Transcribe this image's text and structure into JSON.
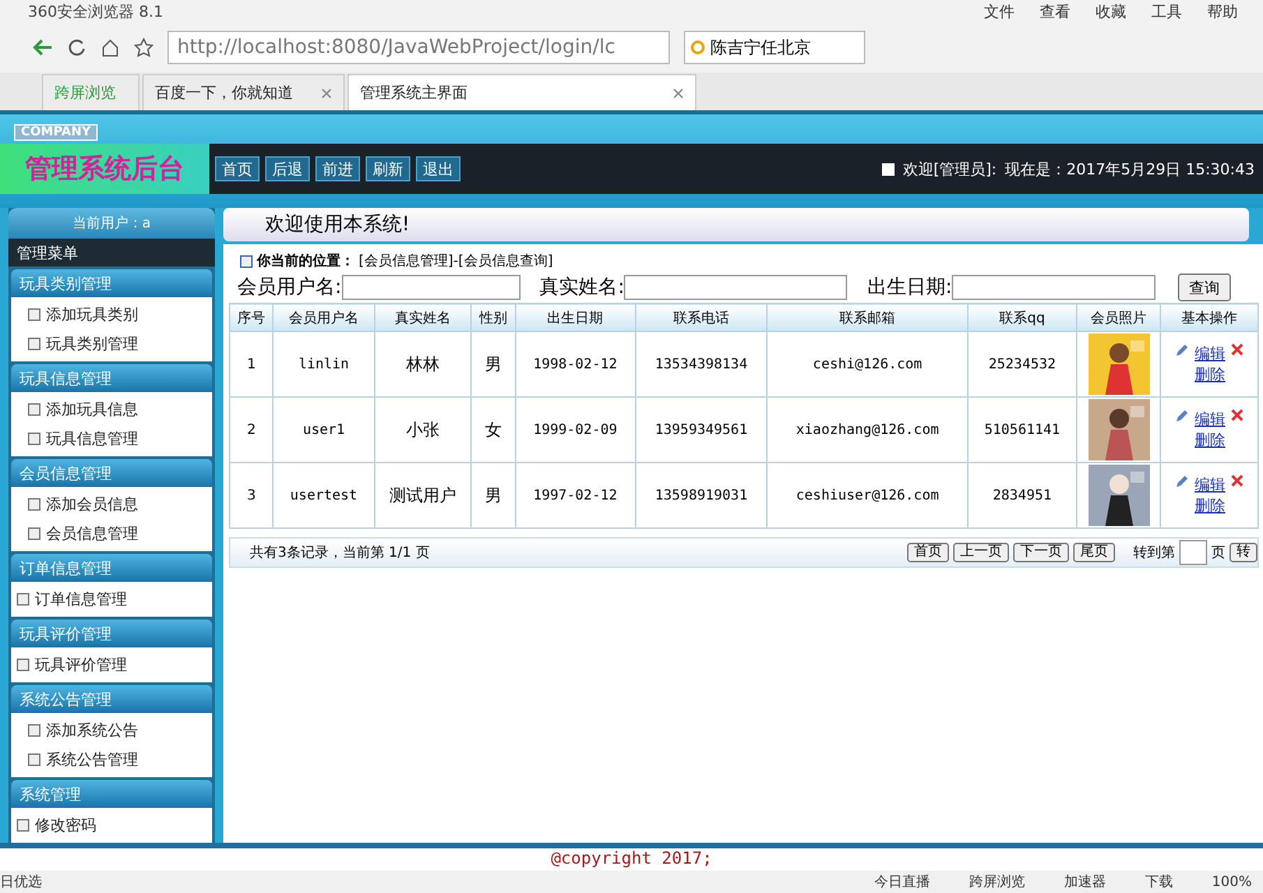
{
  "browser": {
    "title": "360安全浏览器 8.1",
    "menu": [
      "文件",
      "查看",
      "收藏",
      "工具",
      "帮助"
    ],
    "url": "http://localhost:8080/JavaWebProject/login/lc",
    "search": "陈吉宁任北京",
    "tabs": [
      {
        "label": "跨屏浏览",
        "selected": false,
        "closable": false
      },
      {
        "label": "百度一下，你就知道",
        "selected": false,
        "closable": true
      },
      {
        "label": "管理系统主界面",
        "selected": true,
        "closable": true
      }
    ]
  },
  "header": {
    "company": "COMPANY",
    "title": "管理系统后台",
    "nav": [
      "首页",
      "后退",
      "前进",
      "刷新",
      "退出"
    ],
    "welcome": "欢迎[管理员]:",
    "time": "现在是：2017年5月29日 15:30:43"
  },
  "sidebar": {
    "user": "当前用户：a",
    "menu_title": "管理菜单",
    "groups": [
      {
        "title": "玩具类别管理",
        "items": [
          "添加玩具类别",
          "玩具类别管理"
        ]
      },
      {
        "title": "玩具信息管理",
        "items": [
          "添加玩具信息",
          "玩具信息管理"
        ]
      },
      {
        "title": "会员信息管理",
        "items": [
          "添加会员信息",
          "会员信息管理"
        ]
      },
      {
        "title": "订单信息管理",
        "items": [
          "订单信息管理"
        ]
      },
      {
        "title": "玩具评价管理",
        "items": [
          "玩具评价管理"
        ]
      },
      {
        "title": "系统公告管理",
        "items": [
          "添加系统公告",
          "系统公告管理"
        ]
      },
      {
        "title": "系统管理",
        "items": [
          "修改密码"
        ]
      }
    ]
  },
  "main": {
    "welcome": "欢迎使用本系统!",
    "location_label": "你当前的位置：",
    "location": "[会员信息管理]-[会员信息查询]",
    "filters": [
      {
        "label": "会员用户名:"
      },
      {
        "label": "真实姓名:"
      },
      {
        "label": "出生日期:"
      }
    ],
    "query_button": "查询",
    "table": {
      "columns": [
        "序号",
        "会员用户名",
        "真实姓名",
        "性别",
        "出生日期",
        "联系电话",
        "联系邮箱",
        "联系qq",
        "会员照片",
        "基本操作"
      ],
      "rows": [
        {
          "cells": [
            "1",
            "linlin",
            "林林",
            "男",
            "1998-02-12",
            "13534398134",
            "ceshi@126.com",
            "25234532"
          ],
          "edit": "编辑",
          "delete": "删除"
        },
        {
          "cells": [
            "2",
            "user1",
            "小张",
            "女",
            "1999-02-09",
            "13959349561",
            "xiaozhang@126.com",
            "510561141"
          ],
          "edit": "编辑",
          "delete": "删除"
        },
        {
          "cells": [
            "3",
            "usertest",
            "测试用户",
            "男",
            "1997-02-12",
            "13598919031",
            "ceshiuser@126.com",
            "2834951"
          ],
          "edit": "编辑",
          "delete": "删除"
        }
      ]
    },
    "pager": {
      "summary": "共有3条记录，当前第 1/1 页",
      "buttons": [
        "首页",
        "上一页",
        "下一页",
        "尾页"
      ],
      "goto": "转到第",
      "page_unit": "页",
      "go": "转"
    }
  },
  "footer": "@copyright 2017;",
  "status_bar": [
    "日优选",
    "今日直播",
    "跨屏浏览",
    "加速器",
    "下载",
    "100%"
  ]
}
